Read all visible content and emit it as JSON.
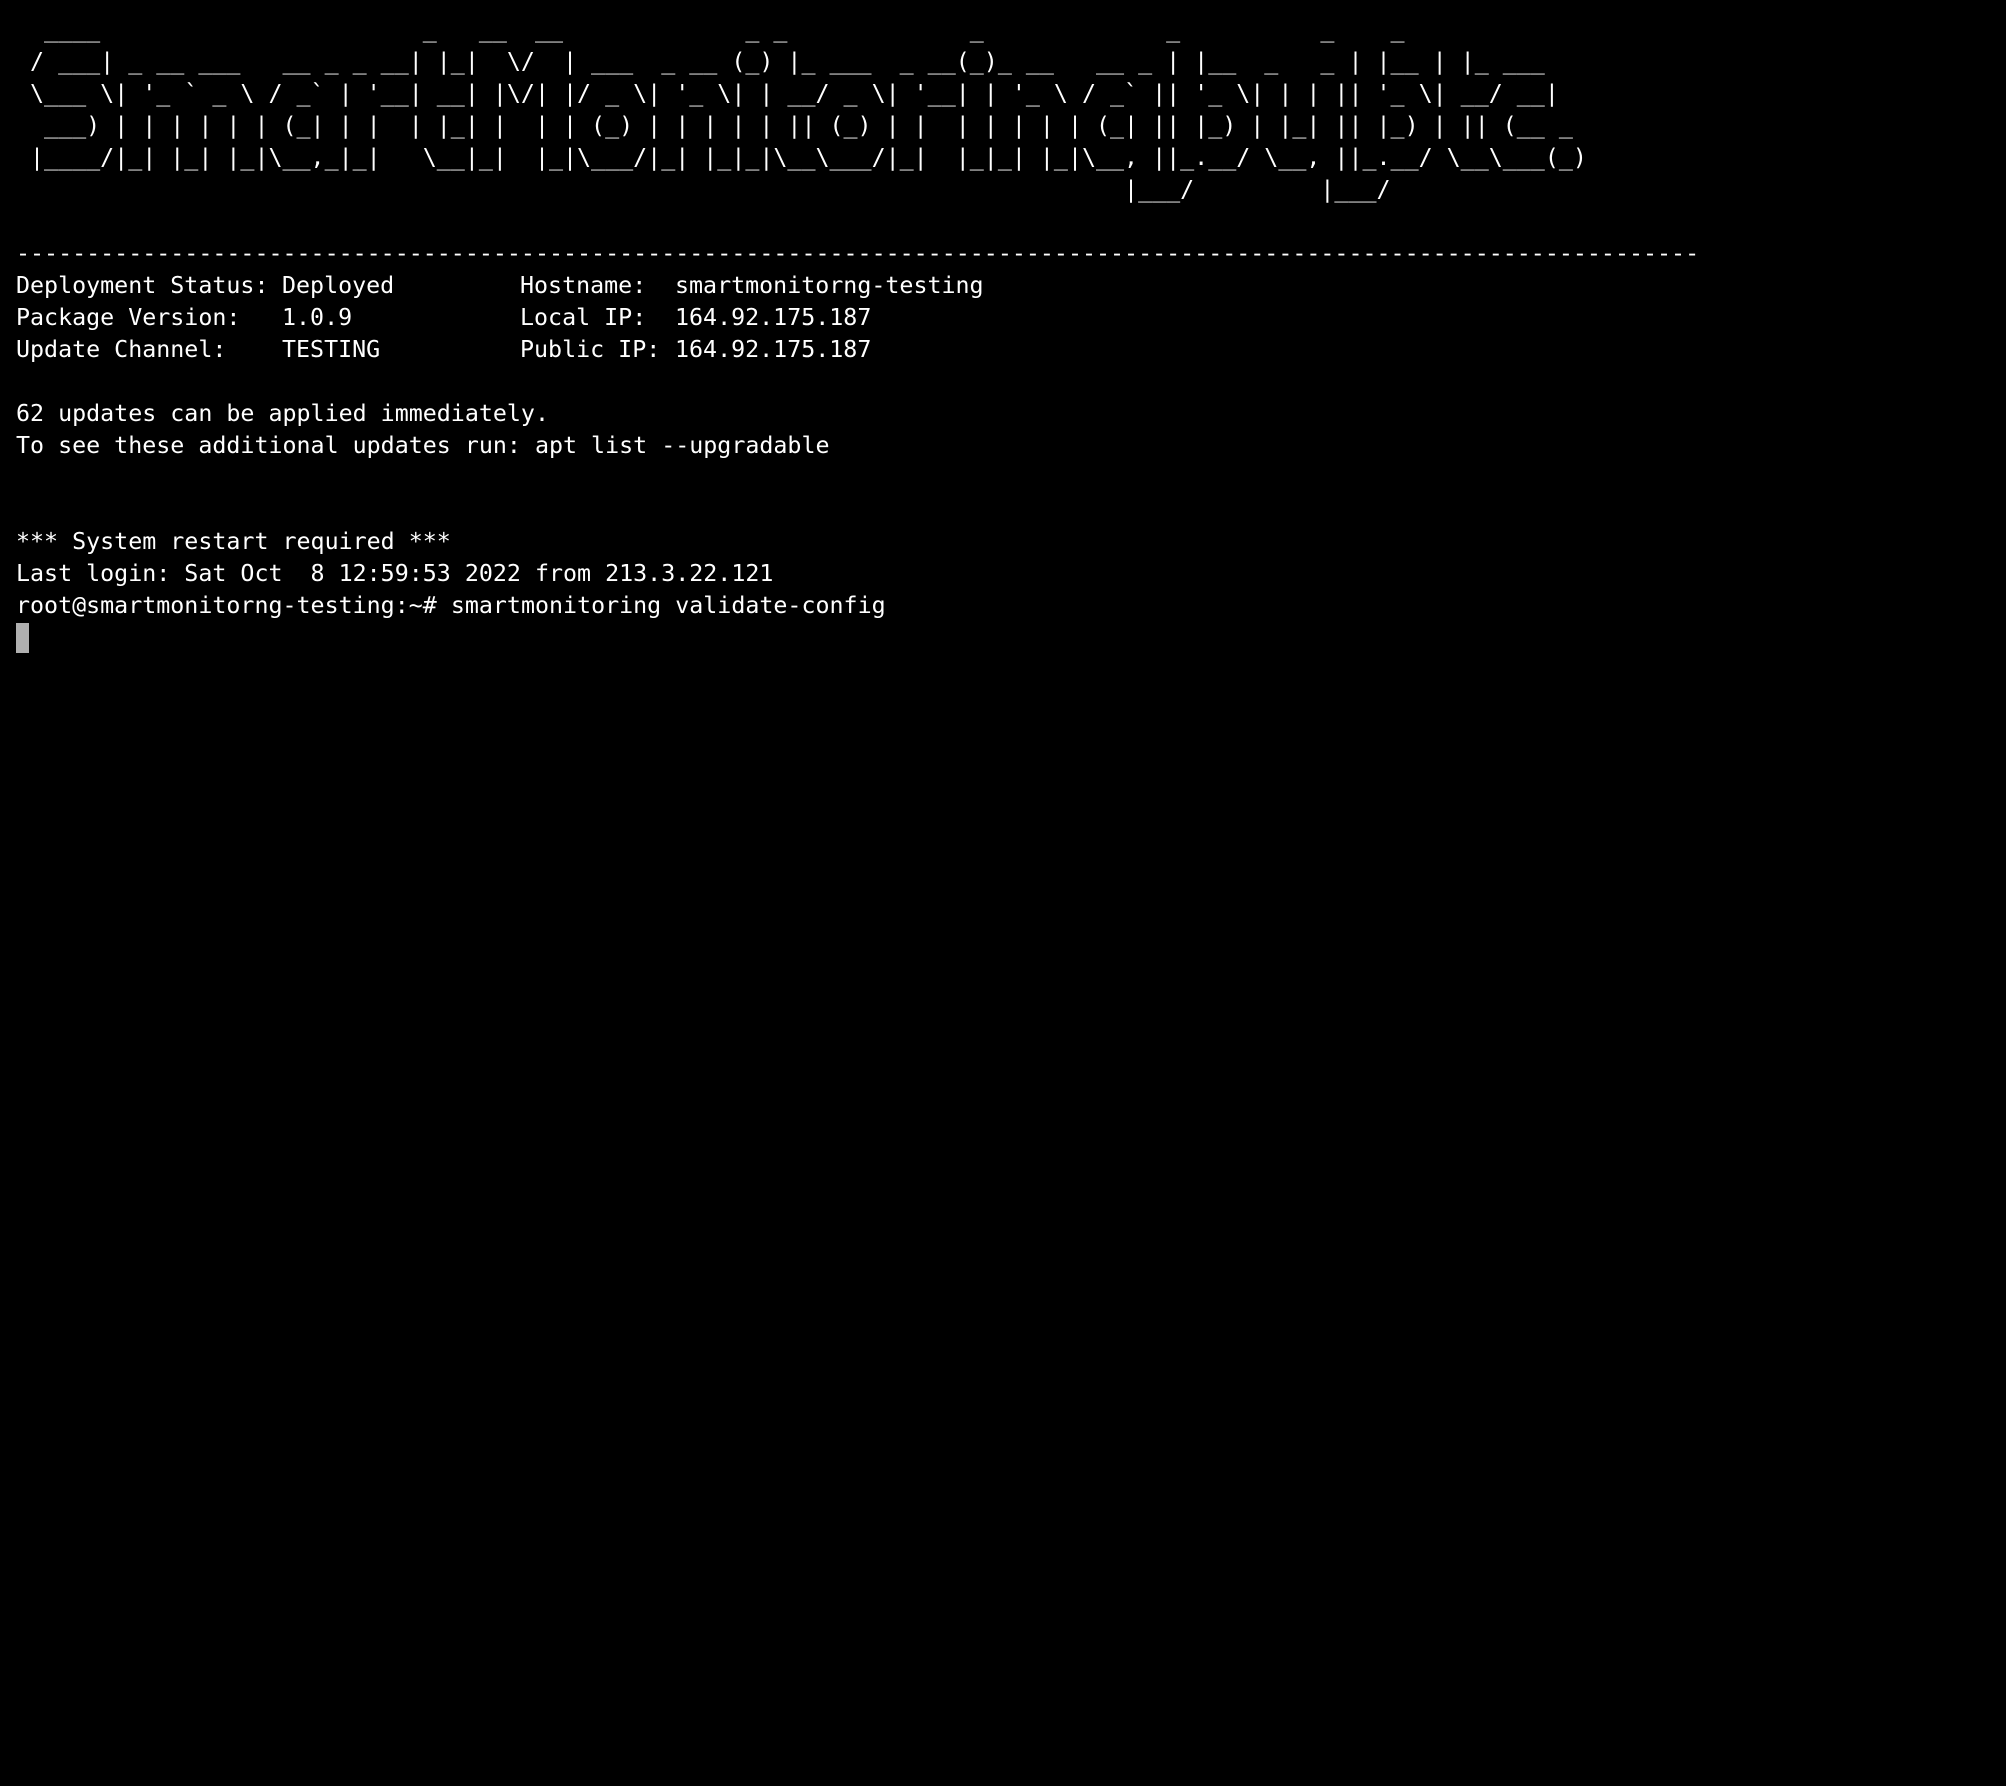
{
  "banner": {
    "lines": [
      "  ____                       _   __  __             _ _             _             _          _    _",
      " / ___| _ __ ___   __ _ _ __| |_|  \\/  | ___  _ __ (_) |_ ___  _ __(_)_ __   __ _ | |__  _   _ | |__ | |_ ___",
      " \\___ \\| '_ ` _ \\ / _` | '__| __| |\\/| |/ _ \\| '_ \\| | __/ _ \\| '__| | '_ \\ / _` || '_ \\| | | || '_ \\| __/ __|",
      "  ___) | | | | | | (_| | |  | |_| |  | | (_) | | | | | || (_) | |  | | | | | (_| || |_) | |_| || |_) | || (__ _",
      " |____/|_| |_| |_|\\__,_|_|   \\__|_|  |_|\\___/|_| |_|_|\\__\\___/|_|  |_|_| |_|\\__, ||_.__/ \\__, ||_.__/ \\__\\___(_)",
      "                                                                               |___/         |___/"
    ]
  },
  "separator": "------------------------------------------------------------------------------------------------------------------------",
  "info": {
    "deployment_status": {
      "label": "Deployment Status:",
      "value": "Deployed"
    },
    "package_version": {
      "label": "Package Version:",
      "value": "1.0.9"
    },
    "update_channel": {
      "label": "Update Channel:",
      "value": "TESTING"
    },
    "hostname": {
      "label": "Hostname:",
      "value": "smartmonitorng-testing"
    },
    "local_ip": {
      "label": "Local IP:",
      "value": "164.92.175.187"
    },
    "public_ip": {
      "label": "Public IP:",
      "value": "164.92.175.187"
    }
  },
  "updates": {
    "count_line": "62 updates can be applied immediately.",
    "hint_line": "To see these additional updates run: apt list --upgradable"
  },
  "restart_notice": "*** System restart required ***",
  "last_login": "Last login: Sat Oct  8 12:59:53 2022 from 213.3.22.121",
  "prompt": {
    "ps1": "root@smartmonitorng-testing:~#",
    "command": "smartmonitoring validate-config"
  },
  "colors": {
    "background": "#000000",
    "foreground": "#ffffff",
    "cursor": "#b0b0b0"
  }
}
